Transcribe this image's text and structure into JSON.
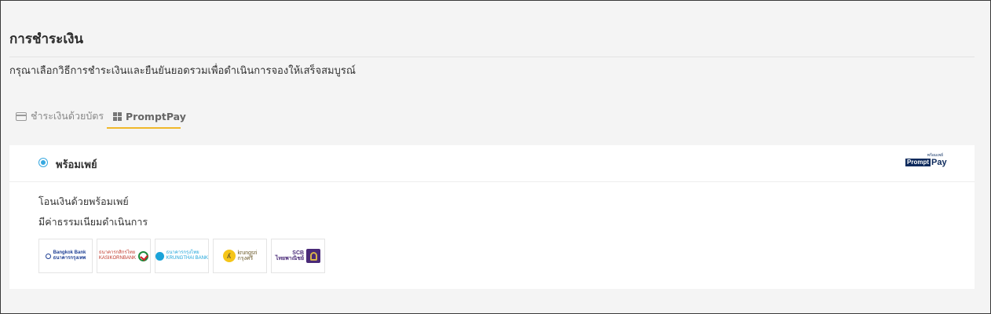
{
  "page": {
    "title": "การชำระเงิน",
    "subtitle": "กรุณาเลือกวิธีการชำระเงินและยืนยันยอดรวมเพื่อดำเนินการจองให้เสร็จสมบูรณ์"
  },
  "tabs": [
    {
      "label": "ชำระเงินด้วยบัตร",
      "icon": "credit-card-icon",
      "active": false
    },
    {
      "label": "PromptPay",
      "icon": "qr-code-icon",
      "active": true
    }
  ],
  "promptpay": {
    "method_label": "พร้อมเพย์",
    "selected": true,
    "logo": {
      "small_text": "พร้อมเพย์",
      "prompt": "Prompt",
      "pay": "Pay"
    },
    "description": "โอนเงินด้วยพร้อมเพย์",
    "fee_note": "มีค่าธรรมเนียมดำเนินการ",
    "banks": [
      {
        "name": "Bangkok Bank",
        "text_top": "Bangkok Bank",
        "text_bottom": "ธนาคารกรุงเทพ"
      },
      {
        "name": "Kasikornbank",
        "text_top": "ธนาคารกสิกรไทย",
        "text_bottom": "KASIKORNBANK"
      },
      {
        "name": "Krungthai",
        "text_top": "ธนาคารกรุงไทย",
        "text_bottom": "KRUNGTHAI BANK"
      },
      {
        "name": "Krungsri",
        "text_top": "krungsri",
        "text_bottom": "กรุงศรี"
      },
      {
        "name": "SCB",
        "text_top": "SCB",
        "text_bottom": "ไทยพาณิชย์"
      }
    ]
  },
  "colors": {
    "accent": "#f0b82a",
    "radio": "#37a8e0",
    "promptpay_navy": "#0d2a5c"
  }
}
